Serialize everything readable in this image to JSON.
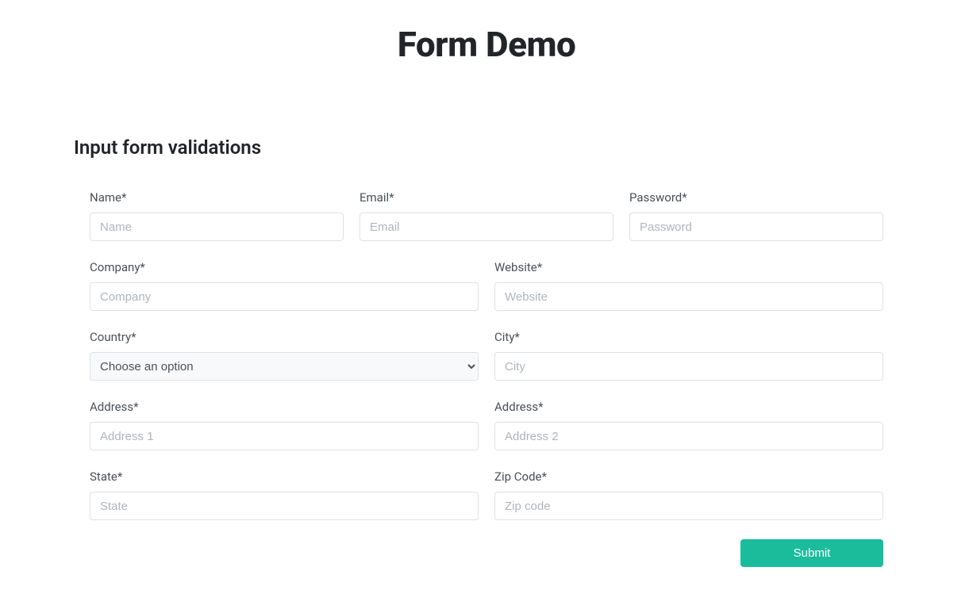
{
  "page_title": "Form Demo",
  "section_title": "Input form validations",
  "fields": {
    "name": {
      "label": "Name*",
      "placeholder": "Name"
    },
    "email": {
      "label": "Email*",
      "placeholder": "Email"
    },
    "password": {
      "label": "Password*",
      "placeholder": "Password"
    },
    "company": {
      "label": "Company*",
      "placeholder": "Company"
    },
    "website": {
      "label": "Website*",
      "placeholder": "Website"
    },
    "country": {
      "label": "Country*",
      "selected": "Choose an option"
    },
    "city": {
      "label": "City*",
      "placeholder": "City"
    },
    "address1": {
      "label": "Address*",
      "placeholder": "Address 1"
    },
    "address2": {
      "label": "Address*",
      "placeholder": "Address 2"
    },
    "state": {
      "label": "State*",
      "placeholder": "State"
    },
    "zip": {
      "label": "Zip Code*",
      "placeholder": "Zip code"
    }
  },
  "submit_label": "Submit"
}
